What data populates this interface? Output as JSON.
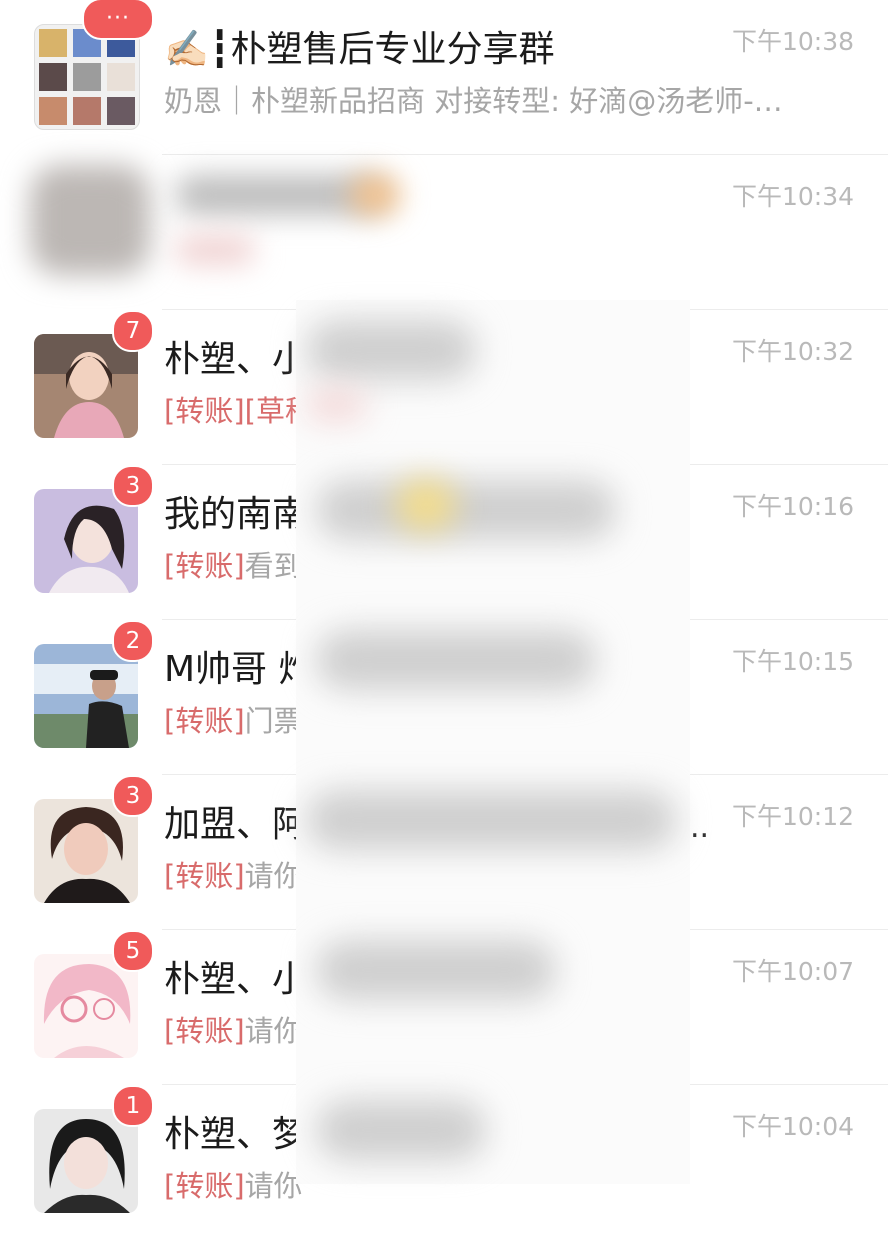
{
  "chats": [
    {
      "title": "✍🏻┇朴塑售后专业分享群",
      "preview": "奶恩｜朴塑新品招商 对接转型: 好滴@汤老师-…",
      "tag": "",
      "time": "下午10:38",
      "badge": "···",
      "avatar": "group-grid"
    },
    {
      "title": "",
      "preview": "",
      "tag": "",
      "time": "下午10:34",
      "badge": "",
      "avatar": "blurred"
    },
    {
      "title": "朴塑、小",
      "preview": "[草稿",
      "tag": "[转账]",
      "time": "下午10:32",
      "badge": "7",
      "avatar": "woman-photo"
    },
    {
      "title": "我的南南",
      "preview": "看到",
      "tag": "[转账]",
      "time": "下午10:16",
      "badge": "3",
      "avatar": "woman-purple"
    },
    {
      "title": "M帅哥 炸",
      "preview": "门票",
      "tag": "[转账]",
      "time": "下午10:15",
      "badge": "2",
      "avatar": "man-sky"
    },
    {
      "title": "加盟、阿",
      "preview": "请你",
      "tag": "[转账]",
      "time": "下午10:12",
      "badge": "3",
      "avatar": "woman-curls"
    },
    {
      "title": "朴塑、小",
      "preview": "请你",
      "tag": "[转账]",
      "time": "下午10:07",
      "badge": "5",
      "avatar": "anime-pink"
    },
    {
      "title": "朴塑、梦",
      "preview": "请你",
      "tag": "[转账]",
      "time": "下午10:04",
      "badge": "1",
      "avatar": "woman-dark"
    }
  ],
  "colors": {
    "badge": "#f05a5a",
    "tag": "#d86b6b",
    "time": "#b9b9b9"
  }
}
